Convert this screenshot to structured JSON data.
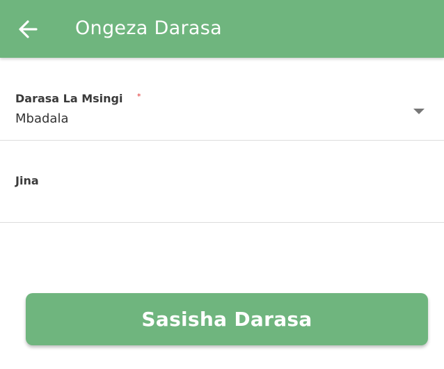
{
  "header": {
    "title": "Ongeza Darasa",
    "back_icon": "arrow-left-icon"
  },
  "form": {
    "base_class": {
      "label": "Darasa La Msingi",
      "required_mark": "*",
      "value": "Mbadala",
      "dropdown_icon": "triangle-down-icon"
    },
    "name": {
      "label": "Jina",
      "value": ""
    }
  },
  "submit_button": {
    "label": "Sasisha Darasa"
  },
  "colors": {
    "primary": "#6fb57e",
    "required": "#e0302f"
  }
}
